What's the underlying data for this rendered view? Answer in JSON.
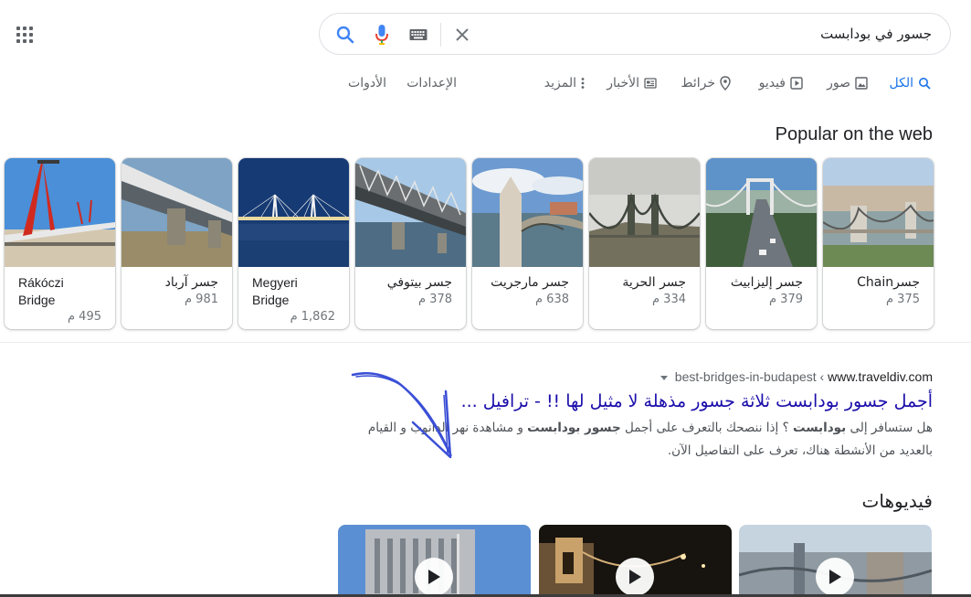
{
  "search": {
    "query": "جسور في بودابست",
    "icons": [
      "search-icon",
      "microphone-icon",
      "keyboard-icon",
      "clear-icon"
    ]
  },
  "tabs": {
    "all": "الكل",
    "images": "صور",
    "videos": "فيديو",
    "maps": "خرائط",
    "news": "الأخبار",
    "more": "المزيد",
    "settings": "الإعدادات",
    "tools": "الأدوات"
  },
  "popular": {
    "title": "Popular on the web",
    "cards": [
      {
        "name": "جسرChain",
        "length": "375 م",
        "thumb": "chain-bridge-photo"
      },
      {
        "name": "جسر إليزابيث",
        "length": "379 م",
        "thumb": "elisabeth-bridge-photo"
      },
      {
        "name": "جسر الحرية",
        "length": "334 م",
        "thumb": "liberty-bridge-photo"
      },
      {
        "name": "جسر مارجريت",
        "length": "638 م",
        "thumb": "margaret-bridge-photo"
      },
      {
        "name": "جسر بيتوفي",
        "length": "378 م",
        "thumb": "petofi-bridge-photo"
      },
      {
        "name": "Megyeri Bridge",
        "length": "1,862 م",
        "thumb": "megyeri-bridge-photo"
      },
      {
        "name": "جسر آرباد",
        "length": "981 م",
        "thumb": "arpad-bridge-photo"
      },
      {
        "name": "Rákóczi Bridge",
        "length": "495 م",
        "thumb": "rakoczi-bridge-photo"
      }
    ]
  },
  "result": {
    "site": "www.traveldiv.com",
    "path": "best-bridges-in-budapest",
    "sep": "‹",
    "title": "أجمل جسور بودابست ثلاثة جسور مذهلة لا مثيل لها !! - ترافيل ...",
    "snippet": {
      "p1": "هل ستسافر إلى ",
      "b1": "بودابست",
      "p2": " ؟ إذا ننصحك بالتعرف على أجمل ",
      "b2": "جسور بودابست",
      "p3": " و مشاهدة نهر الدانوب و القيام بالعديد من الأنشطة هناك، تعرف على التفاصيل الآن."
    }
  },
  "videos": {
    "title": "فيديوهات",
    "items": [
      {
        "thumb": "bridge-night-video",
        "icon": "play-icon"
      },
      {
        "thumb": "chain-bridge-night-video",
        "icon": "play-icon"
      },
      {
        "thumb": "building-video",
        "icon": "play-icon"
      }
    ]
  },
  "colors": {
    "link": "#1a0dab",
    "active_tab": "#1a73e8",
    "annotation": "#3b4fd6"
  }
}
